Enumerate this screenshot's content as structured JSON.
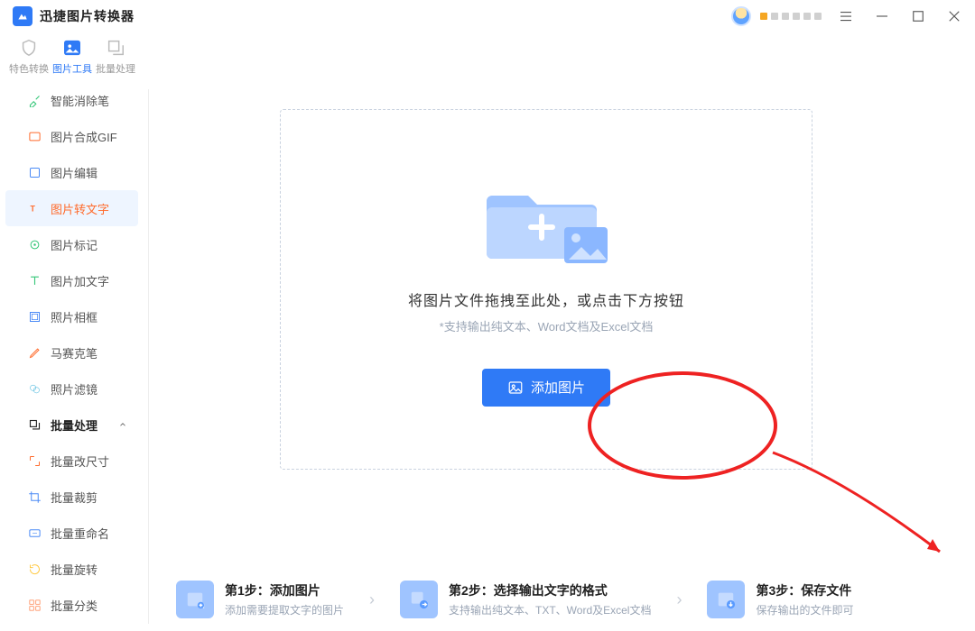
{
  "app": {
    "title": "迅捷图片转换器"
  },
  "nav": {
    "items": [
      {
        "label": "特色转换"
      },
      {
        "label": "图片工具"
      },
      {
        "label": "批量处理"
      }
    ]
  },
  "sidebar": {
    "items": [
      {
        "label": "智能消除笔"
      },
      {
        "label": "图片合成GIF"
      },
      {
        "label": "图片编辑"
      },
      {
        "label": "图片转文字"
      },
      {
        "label": "图片标记"
      },
      {
        "label": "图片加文字"
      },
      {
        "label": "照片相框"
      },
      {
        "label": "马赛克笔"
      },
      {
        "label": "照片滤镜"
      }
    ],
    "section": {
      "label": "批量处理"
    },
    "batch": [
      {
        "label": "批量改尺寸"
      },
      {
        "label": "批量裁剪"
      },
      {
        "label": "批量重命名"
      },
      {
        "label": "批量旋转"
      },
      {
        "label": "批量分类"
      }
    ]
  },
  "dropzone": {
    "line1": "将图片文件拖拽至此处，或点击下方按钮",
    "line2": "*支持输出纯文本、Word文档及Excel文档",
    "button": "添加图片"
  },
  "steps": [
    {
      "title": "第1步：添加图片",
      "desc": "添加需要提取文字的图片"
    },
    {
      "title": "第2步：选择输出文字的格式",
      "desc": "支持输出纯文本、TXT、Word及Excel文档"
    },
    {
      "title": "第3步：保存文件",
      "desc": "保存输出的文件即可"
    }
  ]
}
